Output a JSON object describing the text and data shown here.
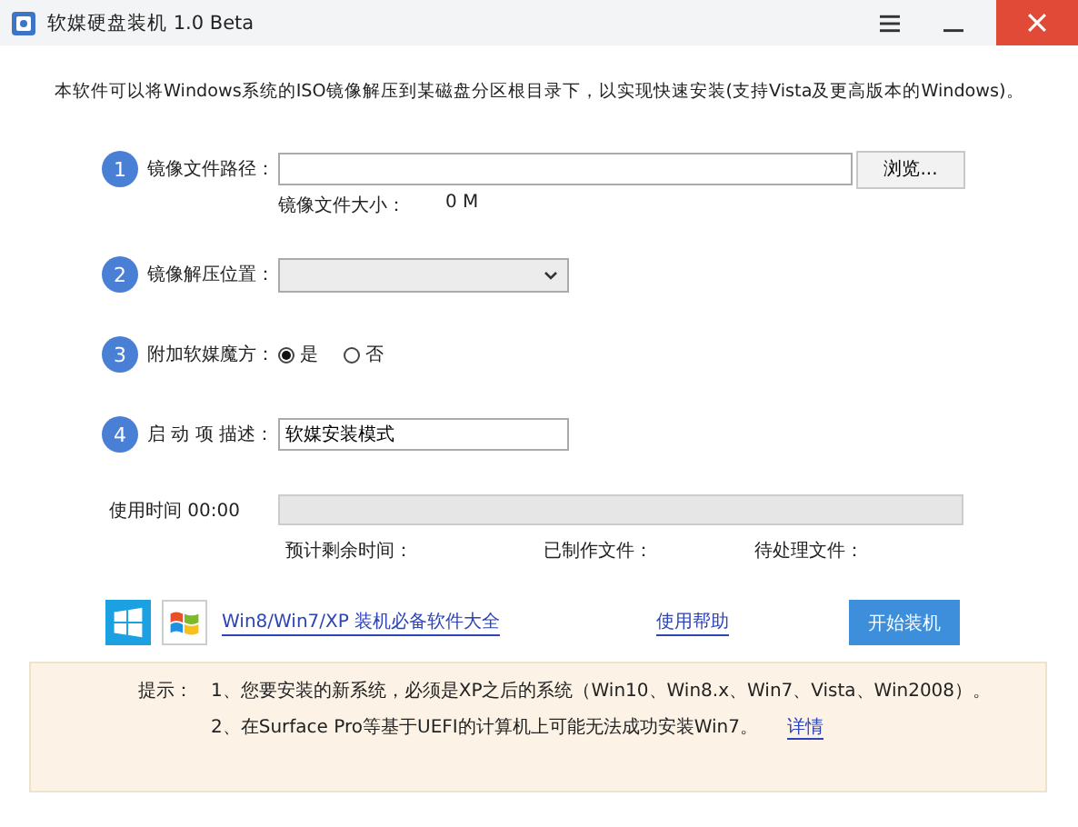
{
  "window": {
    "title": "软媒硬盘装机 1.0 Beta"
  },
  "intro": "本软件可以将Windows系统的ISO镜像解压到某磁盘分区根目录下，以实现快速安装(支持Vista及更高版本的Windows)。",
  "steps": [
    {
      "number": "1",
      "label": "镜像文件路径：",
      "kind": "file",
      "button": "浏览...",
      "size_label": "镜像文件大小：",
      "size_value": "0 M"
    },
    {
      "number": "2",
      "label": "镜像解压位置：",
      "kind": "select"
    },
    {
      "number": "3",
      "label": "附加软媒魔方：",
      "kind": "radio",
      "options": [
        {
          "label": "是",
          "selected": true
        },
        {
          "label": "否",
          "selected": false
        }
      ]
    },
    {
      "number": "4",
      "label": "启 动 项 描述：",
      "kind": "text",
      "value": "软媒安装模式"
    }
  ],
  "progress": {
    "elapsed": "使用时间 00:00",
    "level": 0,
    "remaining_label": "预计剩余时间：",
    "done_label": "已制作文件：",
    "pending_label": "待处理文件："
  },
  "footer": {
    "link": "Win8/Win7/XP 装机必备软件大全",
    "help": "使用帮助",
    "start": "开始装机"
  },
  "tips": {
    "title": "提示：",
    "items": [
      {
        "text": "1、您要安装的新系统，必须是XP之后的系统（Win10、Win8.x、Win7、Vista、Win2008）。"
      },
      {
        "text": "2、在Surface Pro等基于UEFI的计算机上可能无法成功安装Win7。",
        "link": "详情"
      }
    ]
  }
}
